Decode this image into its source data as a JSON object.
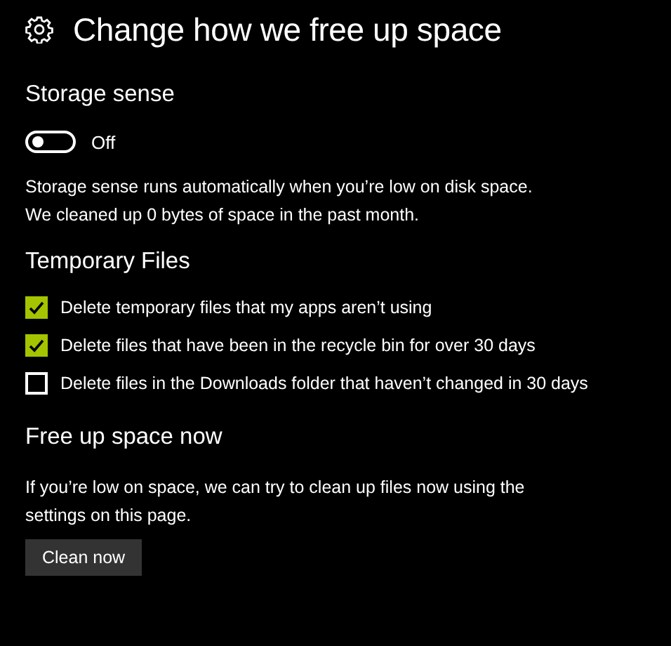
{
  "title": "Change how we free up space",
  "storage_sense": {
    "heading": "Storage sense",
    "toggle": {
      "on": false,
      "label": "Off"
    },
    "description": "Storage sense runs automatically when you’re low on disk space.\nWe cleaned up 0 bytes of space in the past month."
  },
  "temporary_files": {
    "heading": "Temporary Files",
    "options": [
      {
        "label": "Delete temporary files that my apps aren’t using",
        "checked": true
      },
      {
        "label": "Delete files that have been in the recycle bin for over 30 days",
        "checked": true
      },
      {
        "label": "Delete files in the Downloads folder that haven’t changed in 30 days",
        "checked": false
      }
    ]
  },
  "free_up": {
    "heading": "Free up space now",
    "description": "If you’re low on space, we can try to clean up files now using the settings on this page.",
    "button": "Clean now"
  }
}
